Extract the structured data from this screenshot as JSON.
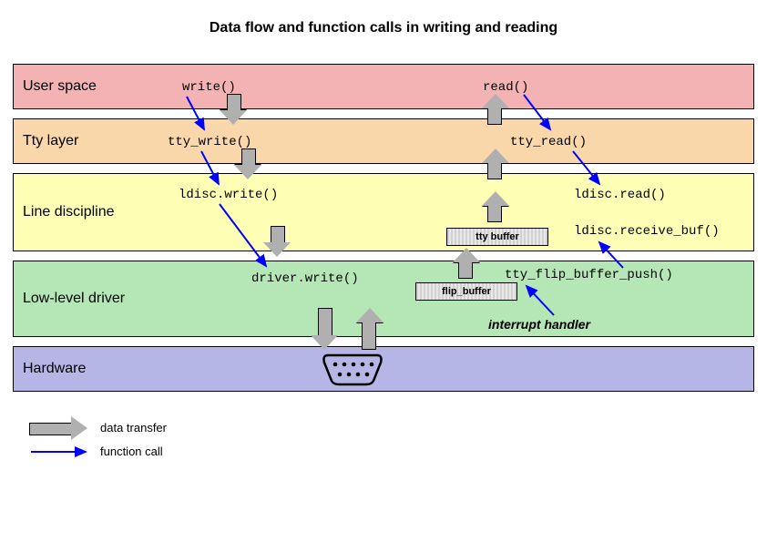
{
  "title": "Data flow and function calls in writing and reading",
  "layers": {
    "user": "User space",
    "tty": "Tty layer",
    "ld": "Line discipline",
    "drv": "Low-level driver",
    "hw": "Hardware"
  },
  "calls": {
    "write": "write()",
    "tty_write": "tty_write()",
    "ldisc_write": "ldisc.write()",
    "driver_write": "driver.write()",
    "read": "read()",
    "tty_read": "tty_read()",
    "ldisc_read": "ldisc.read()",
    "ldisc_recv": "ldisc.receive_buf()",
    "flip_push": "tty_flip_buffer_push()"
  },
  "buffers": {
    "tty_buffer": "tty buffer",
    "flip_buffer": "flip_buffer"
  },
  "annotations": {
    "interrupt": "interrupt handler"
  },
  "legend": {
    "data_transfer": "data transfer",
    "function_call": "function call"
  },
  "colors": {
    "layer_user": "#f3b2b4",
    "layer_tty": "#f9d7aa",
    "layer_ld": "#feffb4",
    "layer_drv": "#b5e6b5",
    "layer_hw": "#b5b5e6",
    "fat_arrow": "#b0b0b0",
    "thin_arrow": "#0000ff"
  }
}
